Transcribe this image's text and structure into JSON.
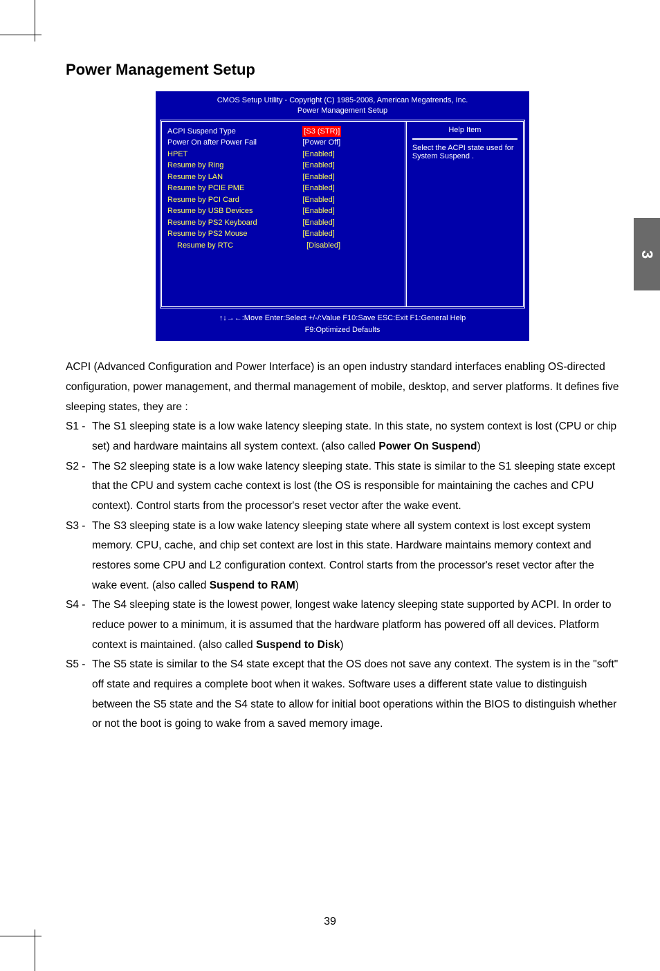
{
  "section_title": "Power Management Setup",
  "bios": {
    "header_line1": "CMOS Setup Utility - Copyright (C) 1985-2008, American Megatrends, Inc.",
    "header_line2": "Power Management Setup",
    "rows": [
      {
        "label": "ACPI Suspend Type",
        "value": "[S3 (STR)]",
        "selected": true
      },
      {
        "label": "Power On after Power Fail",
        "value": "[Power Off]"
      },
      {
        "label": "HPET",
        "value": "[Enabled]",
        "yellow": true
      },
      {
        "label": "Resume by Ring",
        "value": "[Enabled]",
        "yellow": true
      },
      {
        "label": "Resume by LAN",
        "value": "[Enabled]",
        "yellow": true
      },
      {
        "label": "Resume by PCIE PME",
        "value": "[Enabled]",
        "yellow": true
      },
      {
        "label": "Resume by PCI Card",
        "value": "[Enabled]",
        "yellow": true
      },
      {
        "label": "Resume by USB Devices",
        "value": "[Enabled]",
        "yellow": true
      },
      {
        "label": "Resume by PS2 Keyboard",
        "value": "[Enabled]",
        "yellow": true
      },
      {
        "label": "Resume by PS2 Mouse",
        "value": "[Enabled]",
        "yellow": true
      },
      {
        "label": "Resume by RTC",
        "value": "[Disabled]",
        "yellow": true,
        "indent": true
      }
    ],
    "help_title": "Help Item",
    "help_body": "Select the ACPI state used for System Suspend .",
    "footer_line1": "↑↓→←:Move   Enter:Select    +/-/:Value   F10:Save     ESC:Exit   F1:General Help",
    "footer_line2": "F9:Optimized Defaults"
  },
  "side_tab": "3",
  "intro": "ACPI (Advanced Configuration and Power Interface) is an open industry standard interfaces enabling OS-directed configuration, power management, and thermal management of mobile, desktop, and server platforms. It defines five sleeping states, they are :",
  "states": {
    "s1_label": "S1 - ",
    "s1_a": "The S1 sleeping state is a low wake latency sleeping state. In this state, no system context is lost (CPU or chip set) and hardware maintains all system context. (also called ",
    "s1_bold": "Power On Suspend",
    "s1_b": ")",
    "s2_label": "S2 - ",
    "s2": "The S2 sleeping state is a low wake latency sleeping state. This state is similar to the S1 sleeping state except that the CPU and system cache context is lost (the OS is responsible for maintaining the caches and CPU context). Control starts from the processor's reset vector after the wake event.",
    "s3_label": "S3 - ",
    "s3_a": "The S3 sleeping state is a low wake latency sleeping state where all system context is lost except system memory. CPU, cache, and chip set context are lost in this state. Hardware maintains memory context and restores some CPU and L2 configuration context. Control starts from the processor's reset vector after the wake event. (also called ",
    "s3_bold": "Suspend to RAM",
    "s3_b": ")",
    "s4_label": "S4 - ",
    "s4_a": "The S4 sleeping state is the lowest power, longest wake latency sleeping state supported by ACPI. In order to reduce power to a minimum, it is assumed that the hardware platform has powered off all devices. Platform context is maintained. (also called ",
    "s4_bold": "Suspend to Disk",
    "s4_b": ")",
    "s5_label": "S5 - ",
    "s5": "The S5 state is similar to the S4 state except that the OS does not save any context. The system is in the \"soft\" off state and requires a complete boot when it wakes. Software uses a different state value to distinguish between the S5 state and the S4 state to allow for initial boot operations within the BIOS to distinguish whether or not the boot is going to wake from a saved memory image."
  },
  "page_number": "39"
}
